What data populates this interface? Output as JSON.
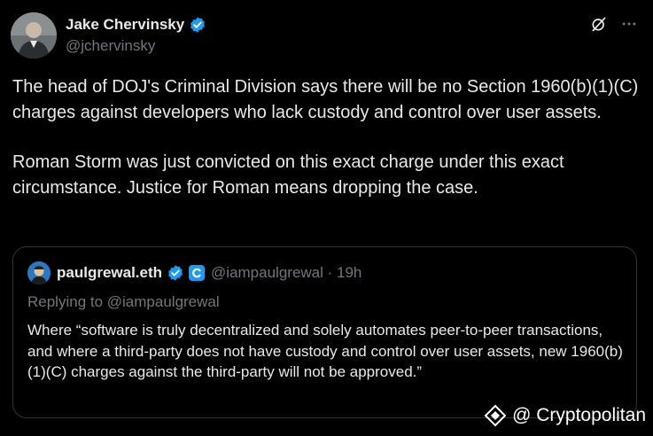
{
  "author": {
    "display_name": "Jake Chervinsky",
    "handle": "@jchervinsky"
  },
  "tweet": {
    "paragraphs": [
      "The head of DOJ's Criminal Division says there will be no Section 1960(b)(1)(C) charges against developers who lack custody and control over user assets.",
      "Roman Storm was just convicted on this exact charge under this exact circumstance. Justice for Roman means dropping the case."
    ]
  },
  "icons": {
    "verified": "verified-badge-icon",
    "grok": "grok-icon",
    "more": "more-options-icon"
  },
  "quoted": {
    "display_name": "paulgrewal.eth",
    "handle_time": "@iampaulgrewal · 19h",
    "replying_to": "Replying to @iampaulgrewal",
    "text": "Where “software is truly decentralized and solely automates peer-to-peer transactions, and where a third-party does not have custody and control over user assets, new 1960(b)(1)(C) charges against the third-party will not be approved.”"
  },
  "watermark": {
    "text": "@ Cryptopolitan"
  },
  "colors": {
    "background": "#000000",
    "text_primary": "#e7e9ea",
    "text_secondary": "#71767b",
    "verified_blue": "#1d9bf0",
    "border": "#2f3336"
  }
}
